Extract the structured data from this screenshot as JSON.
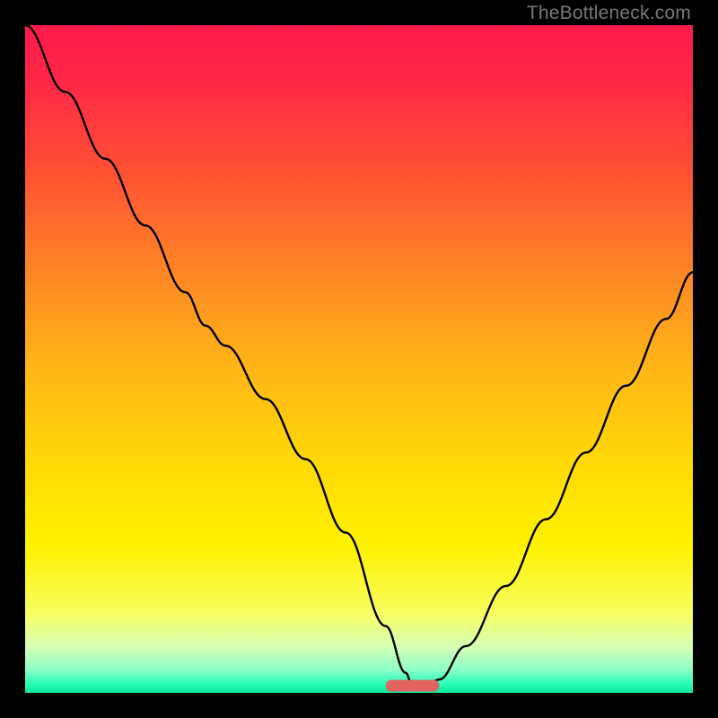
{
  "watermark": "TheBottleneck.com",
  "colors": {
    "black": "#000000",
    "curve": "#000000",
    "gradient_stops": [
      {
        "offset": 0.0,
        "color": "#ff1a4d"
      },
      {
        "offset": 0.08,
        "color": "#ff2647"
      },
      {
        "offset": 0.2,
        "color": "#ff4a36"
      },
      {
        "offset": 0.35,
        "color": "#ff7f27"
      },
      {
        "offset": 0.5,
        "color": "#ffb218"
      },
      {
        "offset": 0.65,
        "color": "#ffd808"
      },
      {
        "offset": 0.78,
        "color": "#fff200"
      },
      {
        "offset": 0.88,
        "color": "#f8ff60"
      },
      {
        "offset": 0.93,
        "color": "#d7ffb4"
      },
      {
        "offset": 0.965,
        "color": "#8effc7"
      },
      {
        "offset": 0.985,
        "color": "#2dffb9"
      },
      {
        "offset": 1.0,
        "color": "#08e89a"
      }
    ],
    "marker": "#e2635f"
  },
  "chart_data": {
    "type": "line",
    "title": "",
    "xlabel": "",
    "ylabel": "",
    "xlim": [
      0,
      100
    ],
    "ylim": [
      0,
      100
    ],
    "marker": {
      "x_start": 54,
      "x_end": 62,
      "y": 1
    },
    "series": [
      {
        "name": "bottleneck-curve",
        "x": [
          0,
          6,
          12,
          18,
          24,
          27,
          30,
          36,
          42,
          48,
          54,
          57,
          58,
          60,
          62,
          66,
          72,
          78,
          84,
          90,
          96,
          100
        ],
        "y": [
          100,
          90,
          80,
          70,
          60,
          55,
          52,
          44,
          35,
          24,
          10,
          3,
          1,
          1,
          2,
          7,
          16,
          26,
          36,
          46,
          56,
          63
        ]
      }
    ]
  }
}
